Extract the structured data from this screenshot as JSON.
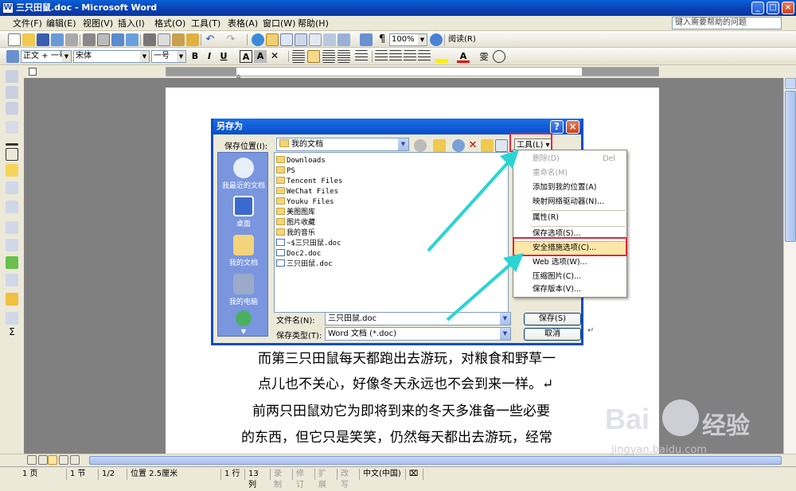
{
  "window": {
    "title": "三只田鼠.doc - Microsoft Word",
    "minimize": "_",
    "maximize": "□",
    "close": "×"
  },
  "menubar": {
    "items": [
      "文件(F)",
      "编辑(E)",
      "视图(V)",
      "插入(I)",
      "格式(O)",
      "工具(T)",
      "表格(A)",
      "窗口(W)",
      "帮助(H)"
    ],
    "help_placeholder": "键入需要帮助的问题"
  },
  "toolbar": {
    "zoom": "100%",
    "read_label": "阅读(R)"
  },
  "format_bar": {
    "style": "正文 + 一号",
    "font": "宋体",
    "size": "一号",
    "bold": "B",
    "italic": "I",
    "underline": "U",
    "char_border": "A",
    "char_shade": "A"
  },
  "document": {
    "lines": [
      "而第三只田鼠每天都跑出去游玩，对粮食和野草一",
      "点儿也不关心，好像冬天永远也不会到来一样。↵",
      "前两只田鼠劝它为即将到来的冬天多准备一些必要",
      "的东西，但它只是笑笑，仍然每天都出去游玩，经常"
    ]
  },
  "dialog": {
    "title": "另存为",
    "save_in_label": "保存位置(I):",
    "save_in_value": "我的文档",
    "tools_button": "工具(L)",
    "places": [
      "我最近的文档",
      "桌面",
      "我的文档",
      "我的电脑",
      ""
    ],
    "files": [
      {
        "name": "Downloads",
        "type": "folder"
      },
      {
        "name": "PS",
        "type": "folder"
      },
      {
        "name": "Tencent Files",
        "type": "folder"
      },
      {
        "name": "WeChat Files",
        "type": "folder"
      },
      {
        "name": "Youku Files",
        "type": "folder"
      },
      {
        "name": "美图图库",
        "type": "folder"
      },
      {
        "name": "图片收藏",
        "type": "folder"
      },
      {
        "name": "我的音乐",
        "type": "folder"
      },
      {
        "name": "~$三只田鼠.doc",
        "type": "doc"
      },
      {
        "name": "Doc2.doc",
        "type": "doc"
      },
      {
        "name": "三只田鼠.doc",
        "type": "doc"
      }
    ],
    "filename_label": "文件名(N):",
    "filename_value": "三只田鼠.doc",
    "filetype_label": "保存类型(T):",
    "filetype_value": "Word 文档 (*.doc)",
    "save_button": "保存(S)",
    "cancel_button": "取消"
  },
  "tools_menu": {
    "items": [
      {
        "label": "删除(D)",
        "shortcut": "Del",
        "enabled": false
      },
      {
        "label": "重命名(M)",
        "shortcut": "",
        "enabled": false
      },
      {
        "label": "添加到我的位置(A)",
        "shortcut": "",
        "enabled": true
      },
      {
        "label": "映射网络驱动器(N)...",
        "shortcut": "",
        "enabled": true
      },
      {
        "label": "属性(R)",
        "shortcut": "",
        "enabled": true
      },
      {
        "label": "保存选项(S)...",
        "shortcut": "",
        "enabled": true
      },
      {
        "label": "安全措施选项(C)...",
        "shortcut": "",
        "enabled": true
      },
      {
        "label": "Web 选项(W)...",
        "shortcut": "",
        "enabled": true
      },
      {
        "label": "压缩图片(C)...",
        "shortcut": "",
        "enabled": true
      },
      {
        "label": "保存版本(V)...",
        "shortcut": "",
        "enabled": true
      }
    ]
  },
  "statusbar": {
    "page": "1 页",
    "section": "1 节",
    "pages": "1/2",
    "position": "位置 2.5厘米",
    "line": "1 行",
    "col": "13 列",
    "rec": "录制",
    "trk": "修订",
    "ext": "扩展",
    "ovr": "改写",
    "lang": "中文(中国)"
  },
  "watermark": {
    "brand": "Bai",
    "brand2": "经验",
    "url": "jingyan.baidu.com"
  },
  "colors": {
    "highlight_red": "#e0283c",
    "arrow_cyan": "#2ad4d4",
    "xp_blue": "#0a4ec4"
  }
}
